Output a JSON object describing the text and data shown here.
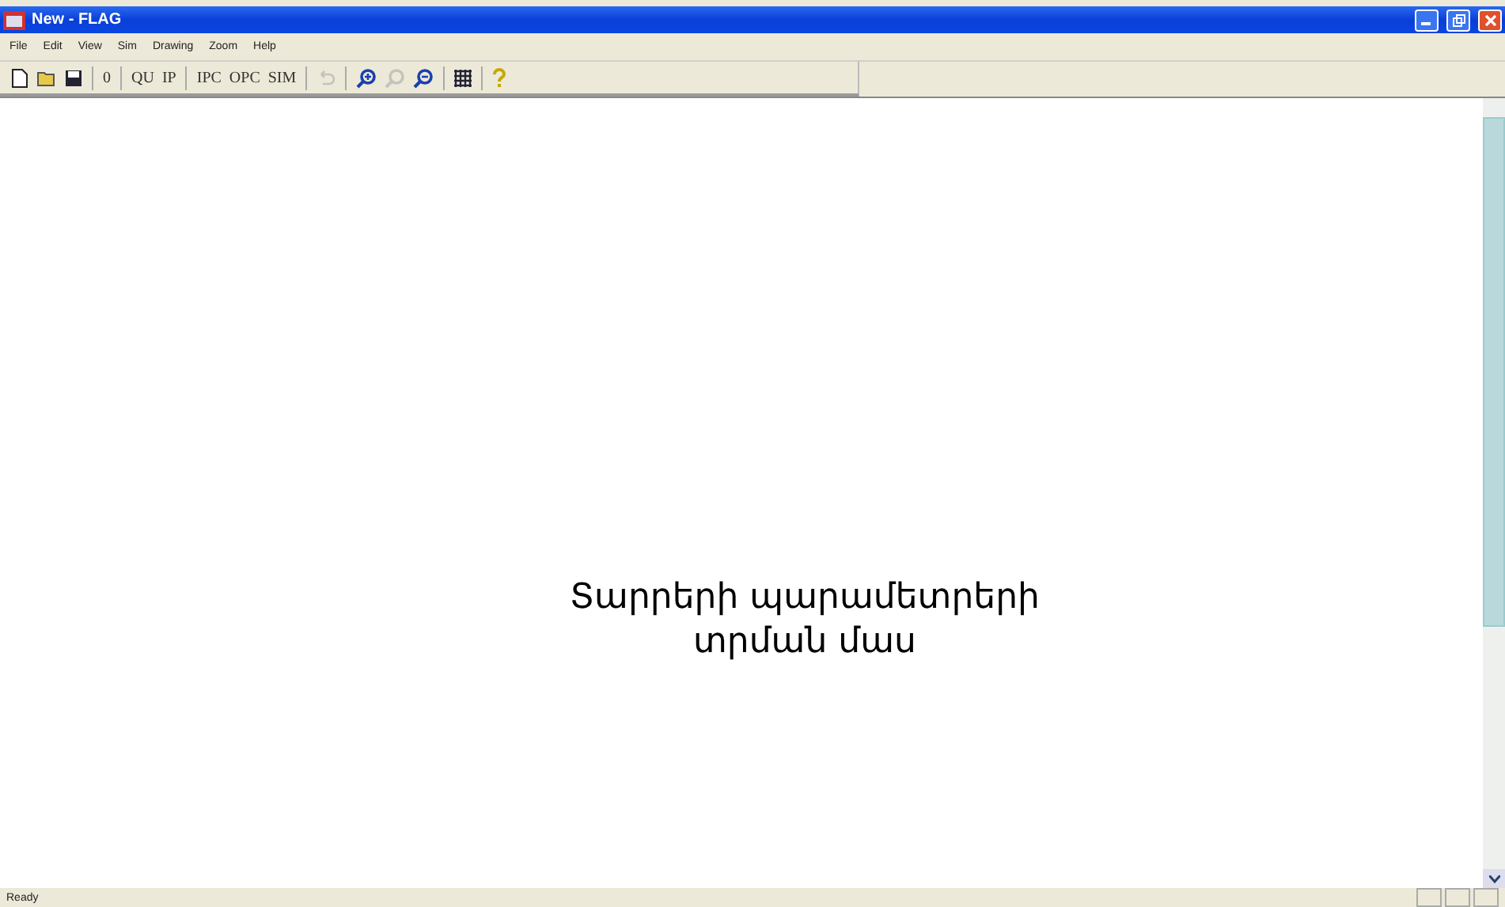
{
  "window": {
    "title": "New - FLAG"
  },
  "menu": [
    "File",
    "Edit",
    "View",
    "Sim",
    "Drawing",
    "Zoom",
    "Help"
  ],
  "toolbar": [
    {
      "kind": "new",
      "disabled": false
    },
    {
      "kind": "open",
      "disabled": false
    },
    {
      "kind": "save",
      "disabled": false
    },
    {
      "kind": "separator"
    },
    {
      "kind": "text",
      "label": "0",
      "disabled": false
    },
    {
      "kind": "separator"
    },
    {
      "kind": "text",
      "label": "QU",
      "disabled": false
    },
    {
      "kind": "text",
      "label": "IP",
      "disabled": false
    },
    {
      "kind": "separator"
    },
    {
      "kind": "text",
      "label": "IPC",
      "disabled": false
    },
    {
      "kind": "text",
      "label": "OPC",
      "disabled": false
    },
    {
      "kind": "text",
      "label": "SIM",
      "disabled": false
    },
    {
      "kind": "separator"
    },
    {
      "kind": "undo",
      "disabled": true
    },
    {
      "kind": "separator"
    },
    {
      "kind": "zoomin",
      "disabled": false
    },
    {
      "kind": "zoom",
      "disabled": true
    },
    {
      "kind": "zoomout",
      "disabled": false
    },
    {
      "kind": "separator"
    },
    {
      "kind": "grid",
      "disabled": false
    },
    {
      "kind": "separator"
    },
    {
      "kind": "help",
      "disabled": false
    }
  ],
  "canvas": {
    "note": "Տարրերի պարամետրերի\nտրման մաս"
  },
  "status_bar": {
    "text": "Ready"
  }
}
